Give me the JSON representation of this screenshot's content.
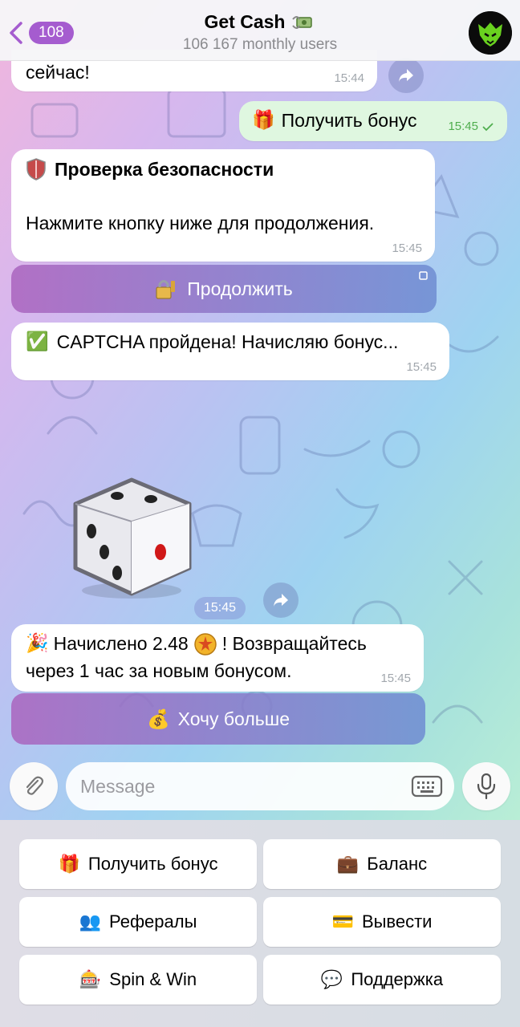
{
  "header": {
    "back_count": "108",
    "title": "Get Cash",
    "title_icon": "money-with-wings",
    "subtitle": "106 167 monthly users",
    "avatar": "wolf-logo"
  },
  "messages": {
    "m1": {
      "text": "сейчас!",
      "time": "15:44"
    },
    "m2": {
      "text": "Получить бонус",
      "time": "15:45",
      "icon": "🎁"
    },
    "m3": {
      "title": "Проверка безопасности",
      "body": "Нажмите кнопку ниже для продолжения.",
      "time": "15:45",
      "icon": "shield"
    },
    "m3_button": {
      "label": "Продолжить",
      "icon": "lock-key"
    },
    "m4": {
      "text": "CAPTCHA пройдена! Начисляю бонус...",
      "time": "15:45",
      "icon": "✅"
    },
    "sticker": {
      "name": "dice",
      "time": "15:45"
    },
    "m5": {
      "line1": "Начислено 2.48",
      "coin": "coin",
      "line1_rest": "! Возвращайтесь",
      "line2": "через 1 час за новым бонусом.",
      "time": "15:45",
      "icon": "🎉"
    },
    "m5_button": {
      "label": "Хочу больше",
      "icon": "💰"
    }
  },
  "composer": {
    "placeholder": "Message"
  },
  "keyboard": {
    "b1": {
      "label": "Получить бонус",
      "icon": "🎁"
    },
    "b2": {
      "label": "Баланс",
      "icon": "💼"
    },
    "b3": {
      "label": "Рефералы",
      "icon": "👥"
    },
    "b4": {
      "label": "Вывести",
      "icon": "💳"
    },
    "b5": {
      "label": "Spin & Win",
      "icon": "🎰"
    },
    "b6": {
      "label": "Поддержка",
      "icon": "💬"
    }
  },
  "colors": {
    "accent": "#a55ccf",
    "outgoing": "#dff7e0",
    "check": "#4fae4e"
  }
}
